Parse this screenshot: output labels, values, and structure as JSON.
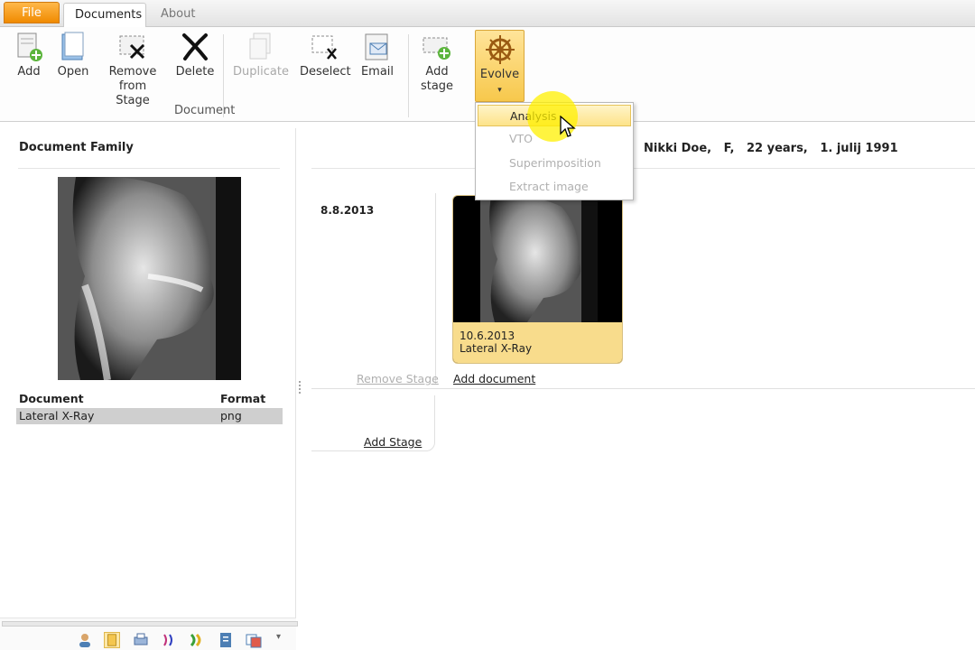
{
  "tabs": {
    "file": "File",
    "documents": "Documents",
    "about": "About"
  },
  "ribbon": {
    "add": "Add",
    "open": "Open",
    "remove_from_stage": [
      "Remove",
      "from Stage"
    ],
    "delete": "Delete",
    "duplicate": "Duplicate",
    "deselect": "Deselect",
    "email": "Email",
    "add_stage": [
      "Add",
      "stage"
    ],
    "evolve": "Evolve",
    "group_document": "Document"
  },
  "evolve_menu": {
    "items": [
      "Analysis",
      "VTO",
      "Superimposition",
      "Extract image"
    ]
  },
  "left_panel": {
    "title": "Document Family",
    "table": {
      "headers": [
        "Document",
        "Format"
      ],
      "rows": [
        {
          "document": "Lateral X-Ray",
          "format": "png"
        }
      ]
    }
  },
  "main": {
    "patient_info": "Nikki Doe,   F,   22 years,   1. julij 1991",
    "stage_date": "8.8.2013",
    "card": {
      "date": "10.6.2013",
      "title": "Lateral X-Ray"
    },
    "remove_stage": "Remove Stage",
    "add_document": "Add document",
    "add_stage": "Add Stage"
  },
  "colors": {
    "file_tab": "#f08a00",
    "evolve_highlight": "#f7c84c",
    "card_caption": "#f8dc8c",
    "selected_row": "#cfcfcf"
  }
}
